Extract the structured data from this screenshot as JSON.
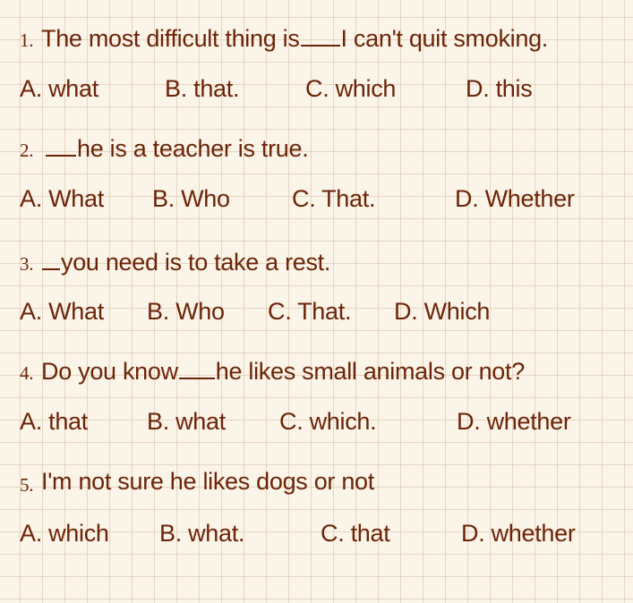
{
  "questions": [
    {
      "number": "1.",
      "text_before": "The most difficult thing is",
      "text_after": "I can't quit smoking.",
      "options": [
        "A. what",
        "B. that.",
        "C. which",
        "D. this"
      ]
    },
    {
      "number": "2.",
      "text_before": "",
      "text_after": "he is a teacher is true.",
      "options": [
        "A. What",
        "B. Who",
        "C. That.",
        "D. Whether"
      ]
    },
    {
      "number": "3.",
      "text_before": "",
      "text_after": "you need is to take a rest.",
      "options": [
        "A. What",
        "B. Who",
        "C. That.",
        "D. Which"
      ]
    },
    {
      "number": "4.",
      "text_before": "Do you know",
      "text_after": "he likes small animals or not?",
      "options": [
        "A. that",
        "B. what",
        "C. which.",
        "D. whether"
      ]
    },
    {
      "number": "5.",
      "text": "I'm not sure he likes dogs or not",
      "options": [
        "A. which",
        "B. what.",
        "C. that",
        "D. whether"
      ]
    }
  ],
  "colors": {
    "text": "#6b2408",
    "background": "#fbf4e8",
    "grid": "#d6bea0"
  }
}
